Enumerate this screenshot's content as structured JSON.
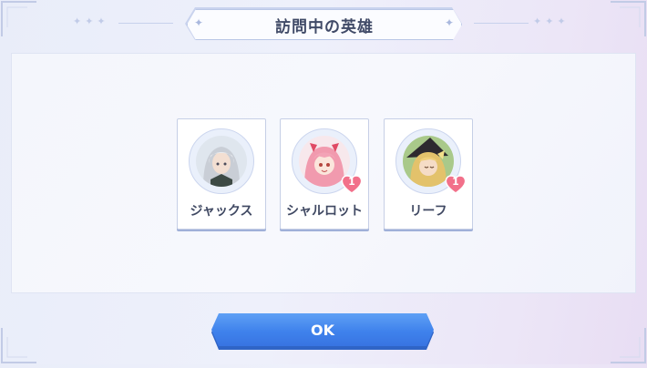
{
  "dialog": {
    "title": "訪問中の英雄",
    "confirm_label": "OK"
  },
  "heroes": [
    {
      "name": "ジャックス",
      "affinity": "",
      "portrait": "silver-haired-hero-portrait"
    },
    {
      "name": "シャルロット",
      "affinity": "1",
      "portrait": "pink-haired-hero-portrait"
    },
    {
      "name": "リーフ",
      "affinity": "1",
      "portrait": "blonde-witch-hero-portrait"
    }
  ],
  "colors": {
    "accent": "#3f82ec",
    "heart": "#f2708a",
    "title_text": "#404a67"
  }
}
